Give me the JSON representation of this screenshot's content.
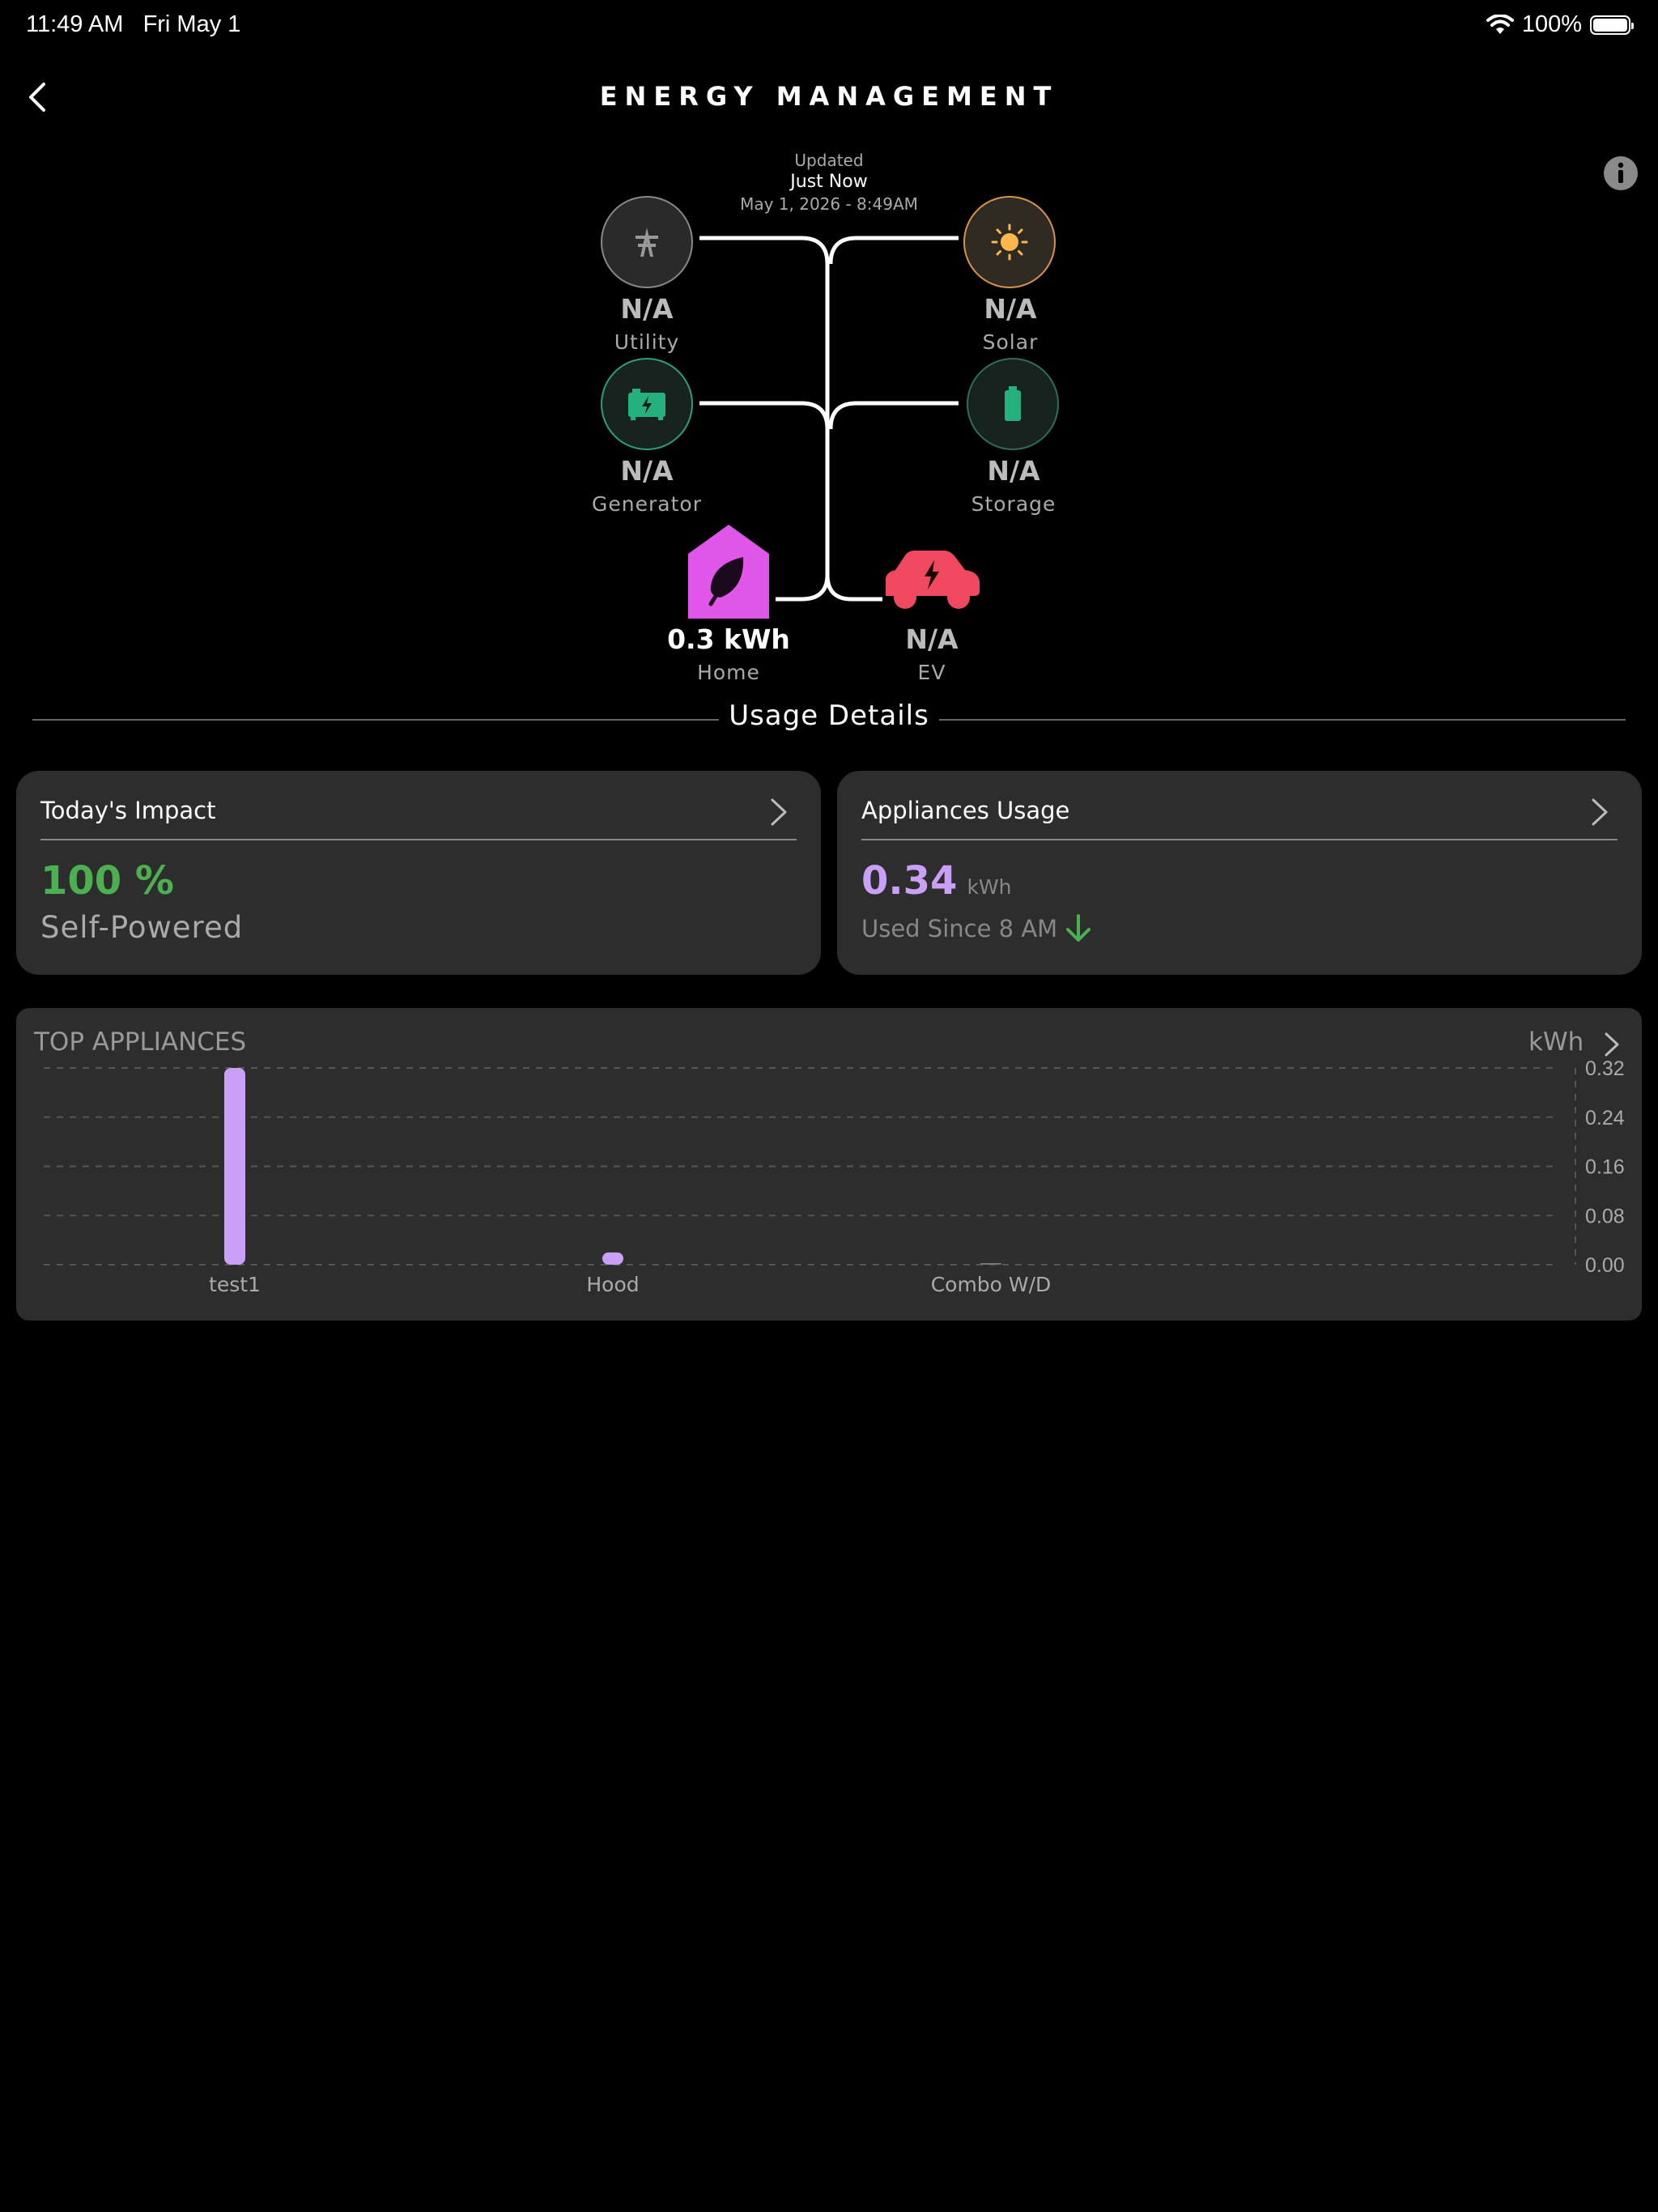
{
  "status_bar": {
    "time": "11:49 AM",
    "date": "Fri May 1",
    "battery": "100%"
  },
  "header": {
    "title": "ENERGY MANAGEMENT"
  },
  "updated": {
    "label": "Updated",
    "relative": "Just Now",
    "timestamp": "May 1, 2026 - 8:49AM"
  },
  "flow": {
    "utility": {
      "value": "N/A",
      "label": "Utility"
    },
    "solar": {
      "value": "N/A",
      "label": "Solar"
    },
    "generator": {
      "value": "N/A",
      "label": "Generator"
    },
    "storage": {
      "value": "N/A",
      "label": "Storage"
    },
    "home": {
      "value": "0.3 kWh",
      "label": "Home"
    },
    "ev": {
      "value": "N/A",
      "label": "EV"
    }
  },
  "usage": {
    "title": "Usage Details"
  },
  "impact": {
    "title": "Today's Impact",
    "value": "100 %",
    "caption": "Self-Powered"
  },
  "appliances_usage": {
    "title": "Appliances Usage",
    "value": "0.34",
    "unit": "kWh",
    "caption": "Used Since 8 AM"
  },
  "colors": {
    "green": "#4caf50",
    "purple": "#c9a0f5",
    "home": "#e056e8",
    "ev": "#f0485e",
    "solar": "#ffb74d"
  },
  "chart_data": {
    "type": "bar",
    "title": "TOP APPLIANCES",
    "ylabel": "kWh",
    "categories": [
      "test1",
      "Hood",
      "Combo W/D"
    ],
    "values": [
      0.32,
      0.02,
      0.001
    ],
    "ylim": [
      0,
      0.32
    ],
    "yticks": [
      "0.32",
      "0.24",
      "0.16",
      "0.08",
      "0.00"
    ],
    "grid": true
  }
}
